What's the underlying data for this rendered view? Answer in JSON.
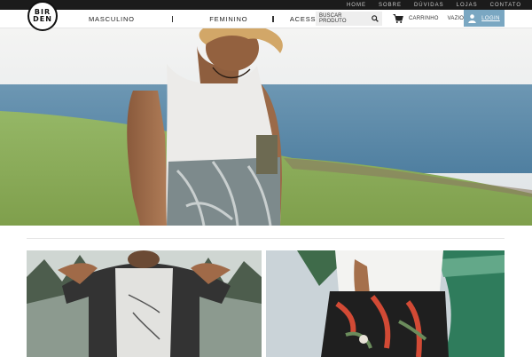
{
  "top_nav": [
    "HOME",
    "SOBRE",
    "DÚVIDAS",
    "LOJAS",
    "CONTATO"
  ],
  "logo": {
    "line1": "BIR",
    "line2": "DEN"
  },
  "categories": [
    "MASCULINO",
    "FEMININO",
    "ACESSÓRIOS"
  ],
  "search": {
    "placeholder": "BUSCAR PRODUTO",
    "icon": "search-icon"
  },
  "cart": {
    "label": "CARRINHO",
    "status": "VAZIO",
    "icon": "cart-icon"
  },
  "login": {
    "label": "LOGIN",
    "icon": "user-icon"
  },
  "carousel": {
    "slides": 4,
    "active": 1
  },
  "colors": {
    "topbar": "#1b1b1b",
    "accent": "#7aa7c2",
    "sea": "#5f8ead",
    "grass": "#8fb25a"
  }
}
